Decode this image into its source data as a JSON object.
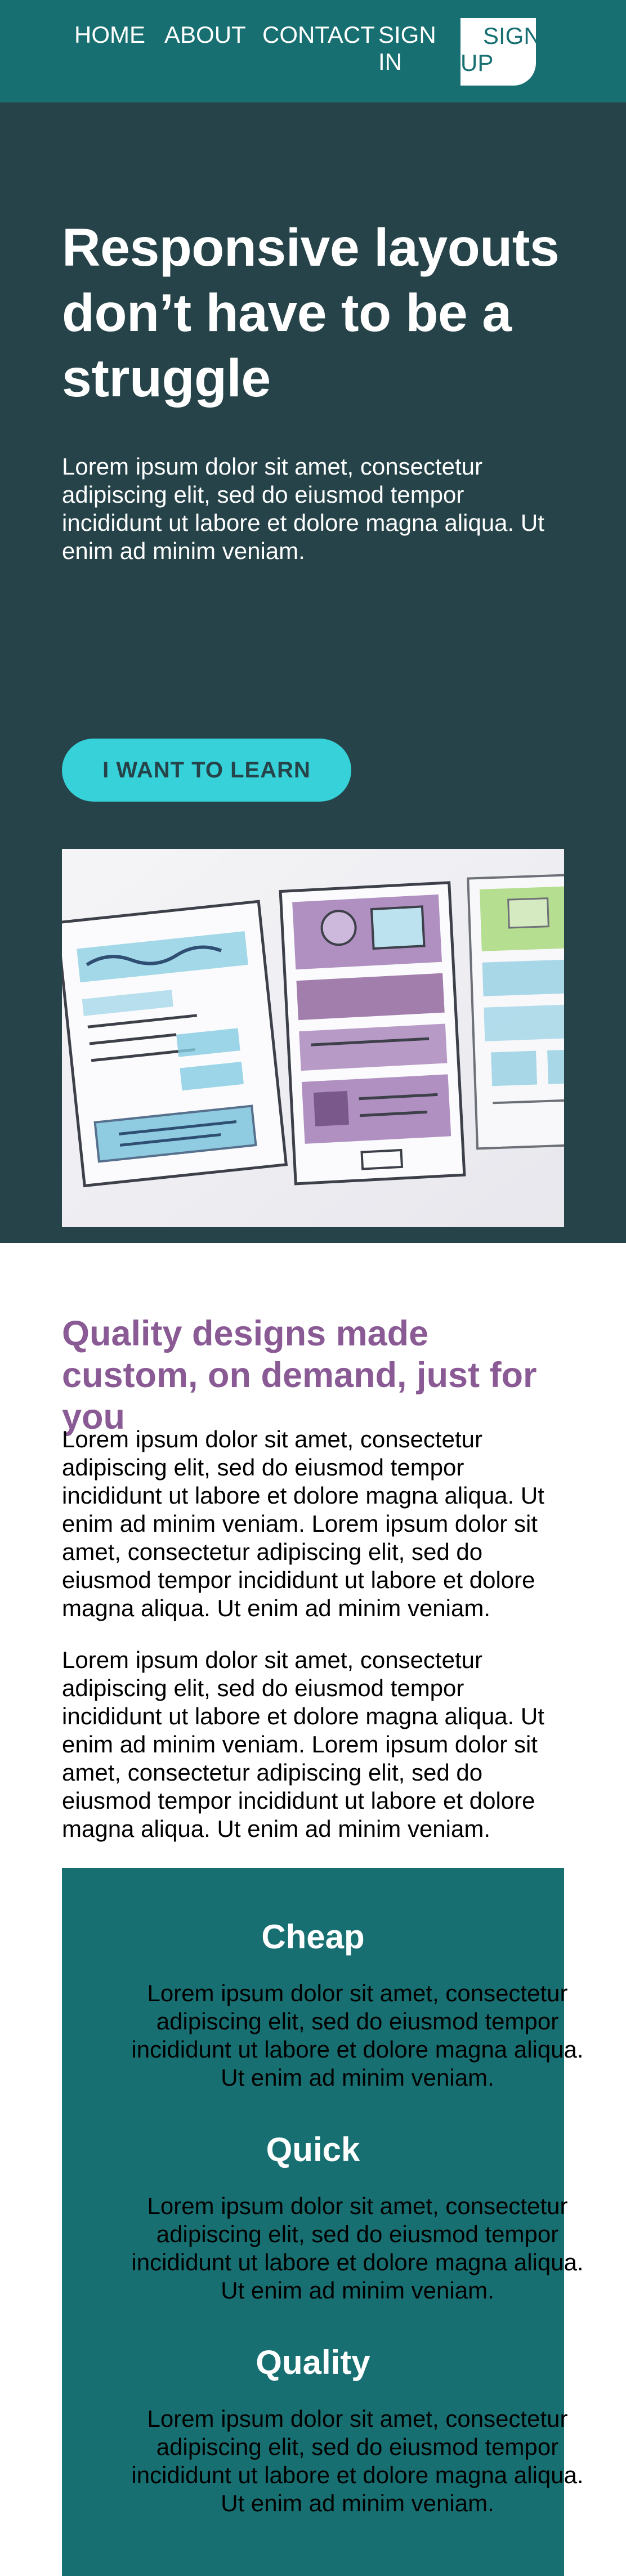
{
  "nav": {
    "home": "HOME",
    "about": "ABOUT",
    "contact": "CONTACT",
    "signin": "SIGN IN",
    "signup_line1": "SIGN",
    "signup_line2": "UP"
  },
  "hero": {
    "title": "Responsive layouts don’t have to be a struggle",
    "text": "Lorem ipsum dolor sit amet, consectetur adipiscing elit, sed do eiusmod tempor incididunt ut labore et dolore magna aliqua. Ut enim ad minim veniam.",
    "cta": "I WANT TO LEARN"
  },
  "about": {
    "title": "Quality designs made custom, on demand, just for you",
    "p1": "Lorem ipsum dolor sit amet, consectetur adipiscing elit, sed do eiusmod tempor incididunt ut labore et dolore magna aliqua. Ut enim ad minim veniam. Lorem ipsum dolor sit amet, consectetur adipiscing elit, sed do eiusmod tempor incididunt ut labore et dolore magna aliqua. Ut enim ad minim veniam.",
    "p2": "Lorem ipsum dolor sit amet, consectetur adipiscing elit, sed do eiusmod tempor incididunt ut labore et dolore magna aliqua. Ut enim ad minim veniam. Lorem ipsum dolor sit amet, consectetur adipiscing elit, sed do eiusmod tempor incididunt ut labore et dolore magna aliqua. Ut enim ad minim veniam."
  },
  "features": [
    {
      "title": "Cheap",
      "text": "Lorem ipsum dolor sit amet, consectetur adipiscing elit, sed do eiusmod tempor incididunt ut labore et dolore magna aliqua. Ut enim ad minim veniam."
    },
    {
      "title": "Quick",
      "text": "Lorem ipsum dolor sit amet, consectetur adipiscing elit, sed do eiusmod tempor incididunt ut labore et dolore magna aliqua. Ut enim ad minim veniam."
    },
    {
      "title": "Quality",
      "text": "Lorem ipsum dolor sit amet, consectetur adipiscing elit, sed do eiusmod tempor incididunt ut labore et dolore magna aliqua. Ut enim ad minim veniam."
    }
  ],
  "colors": {
    "nav_bg": "#186f71",
    "hero_bg": "#254348",
    "accent": "#36d1d9",
    "heading_purple": "#8a5a95",
    "feature_bg": "#186f71"
  },
  "icons": {
    "hero_image": "wireframe-sketches-illustration"
  }
}
